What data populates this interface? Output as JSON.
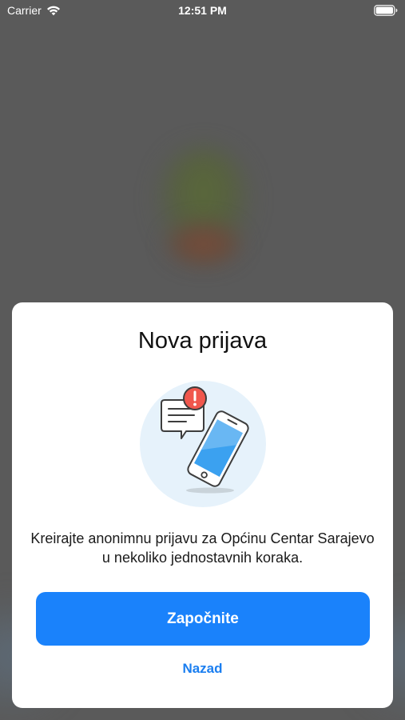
{
  "status_bar": {
    "carrier": "Carrier",
    "time": "12:51 PM"
  },
  "modal": {
    "title": "Nova prijava",
    "description": "Kreirajte anonimnu prijavu za Općinu Centar Sarajevo u nekoliko jednostavnih koraka.",
    "primary_button_label": "Započnite",
    "secondary_link_label": "Nazad"
  },
  "icons": {
    "wifi": "wifi-icon",
    "battery": "battery-icon",
    "illustration": "report-phone-illustration",
    "message": "message-bubble-icon",
    "alert": "alert-badge-icon",
    "phone": "smartphone-icon"
  },
  "colors": {
    "accent": "#1a82fb",
    "alert": "#f0574d",
    "illustration_bg": "#e6f2fb",
    "phone_screen": "#3ba1f0",
    "overlay": "#5a5a5a"
  }
}
